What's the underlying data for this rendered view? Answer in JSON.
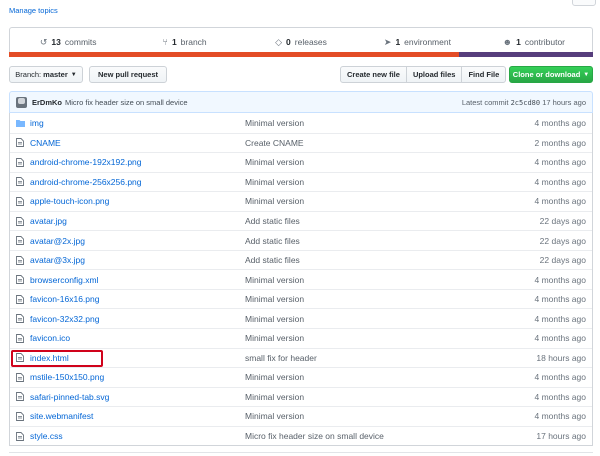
{
  "manage_topics": "Manage topics",
  "summary": {
    "commits": {
      "count": "13",
      "label": "commits",
      "icon": "history-icon"
    },
    "branches": {
      "count": "1",
      "label": "branch",
      "icon": "branch-icon"
    },
    "releases": {
      "count": "0",
      "label": "releases",
      "icon": "tag-icon"
    },
    "environments": {
      "count": "1",
      "label": "environment",
      "icon": "rocket-icon"
    },
    "contributors": {
      "count": "1",
      "label": "contributor",
      "icon": "people-icon"
    }
  },
  "language_bar": [
    {
      "color": "#e34c26",
      "fraction": 0.77
    },
    {
      "color": "#563d7c",
      "fraction": 0.23
    }
  ],
  "toolbar": {
    "branch_prefix": "Branch:",
    "branch_name": "master",
    "new_pull_request": "New pull request",
    "create_new_file": "Create new file",
    "upload_files": "Upload files",
    "find_file": "Find File",
    "clone_or_download": "Clone or download"
  },
  "commit": {
    "author": "ErDmKo",
    "message": "Micro fix header size on small device",
    "latest_label": "Latest commit",
    "sha": "2c5cd80",
    "age": "17 hours ago"
  },
  "files": [
    {
      "type": "dir",
      "name": "img",
      "message": "Minimal version",
      "age": "4 months ago"
    },
    {
      "type": "file",
      "name": "CNAME",
      "message": "Create CNAME",
      "age": "2 months ago"
    },
    {
      "type": "file",
      "name": "android-chrome-192x192.png",
      "message": "Minimal version",
      "age": "4 months ago"
    },
    {
      "type": "file",
      "name": "android-chrome-256x256.png",
      "message": "Minimal version",
      "age": "4 months ago"
    },
    {
      "type": "file",
      "name": "apple-touch-icon.png",
      "message": "Minimal version",
      "age": "4 months ago"
    },
    {
      "type": "file",
      "name": "avatar.jpg",
      "message": "Add static files",
      "age": "22 days ago"
    },
    {
      "type": "file",
      "name": "avatar@2x.jpg",
      "message": "Add static files",
      "age": "22 days ago"
    },
    {
      "type": "file",
      "name": "avatar@3x.jpg",
      "message": "Add static files",
      "age": "22 days ago"
    },
    {
      "type": "file",
      "name": "browserconfig.xml",
      "message": "Minimal version",
      "age": "4 months ago"
    },
    {
      "type": "file",
      "name": "favicon-16x16.png",
      "message": "Minimal version",
      "age": "4 months ago"
    },
    {
      "type": "file",
      "name": "favicon-32x32.png",
      "message": "Minimal version",
      "age": "4 months ago"
    },
    {
      "type": "file",
      "name": "favicon.ico",
      "message": "Minimal version",
      "age": "4 months ago"
    },
    {
      "type": "file",
      "name": "index.html",
      "message": "small fix for header",
      "age": "18 hours ago",
      "highlighted": true
    },
    {
      "type": "file",
      "name": "mstile-150x150.png",
      "message": "Minimal version",
      "age": "4 months ago"
    },
    {
      "type": "file",
      "name": "safari-pinned-tab.svg",
      "message": "Minimal version",
      "age": "4 months ago"
    },
    {
      "type": "file",
      "name": "site.webmanifest",
      "message": "Minimal version",
      "age": "4 months ago"
    },
    {
      "type": "file",
      "name": "style.css",
      "message": "Micro fix header size on small device",
      "age": "17 hours ago"
    }
  ],
  "colors": {
    "link": "#0366d6",
    "highlight_border": "#d0021b",
    "clone_button": "#28a745"
  }
}
